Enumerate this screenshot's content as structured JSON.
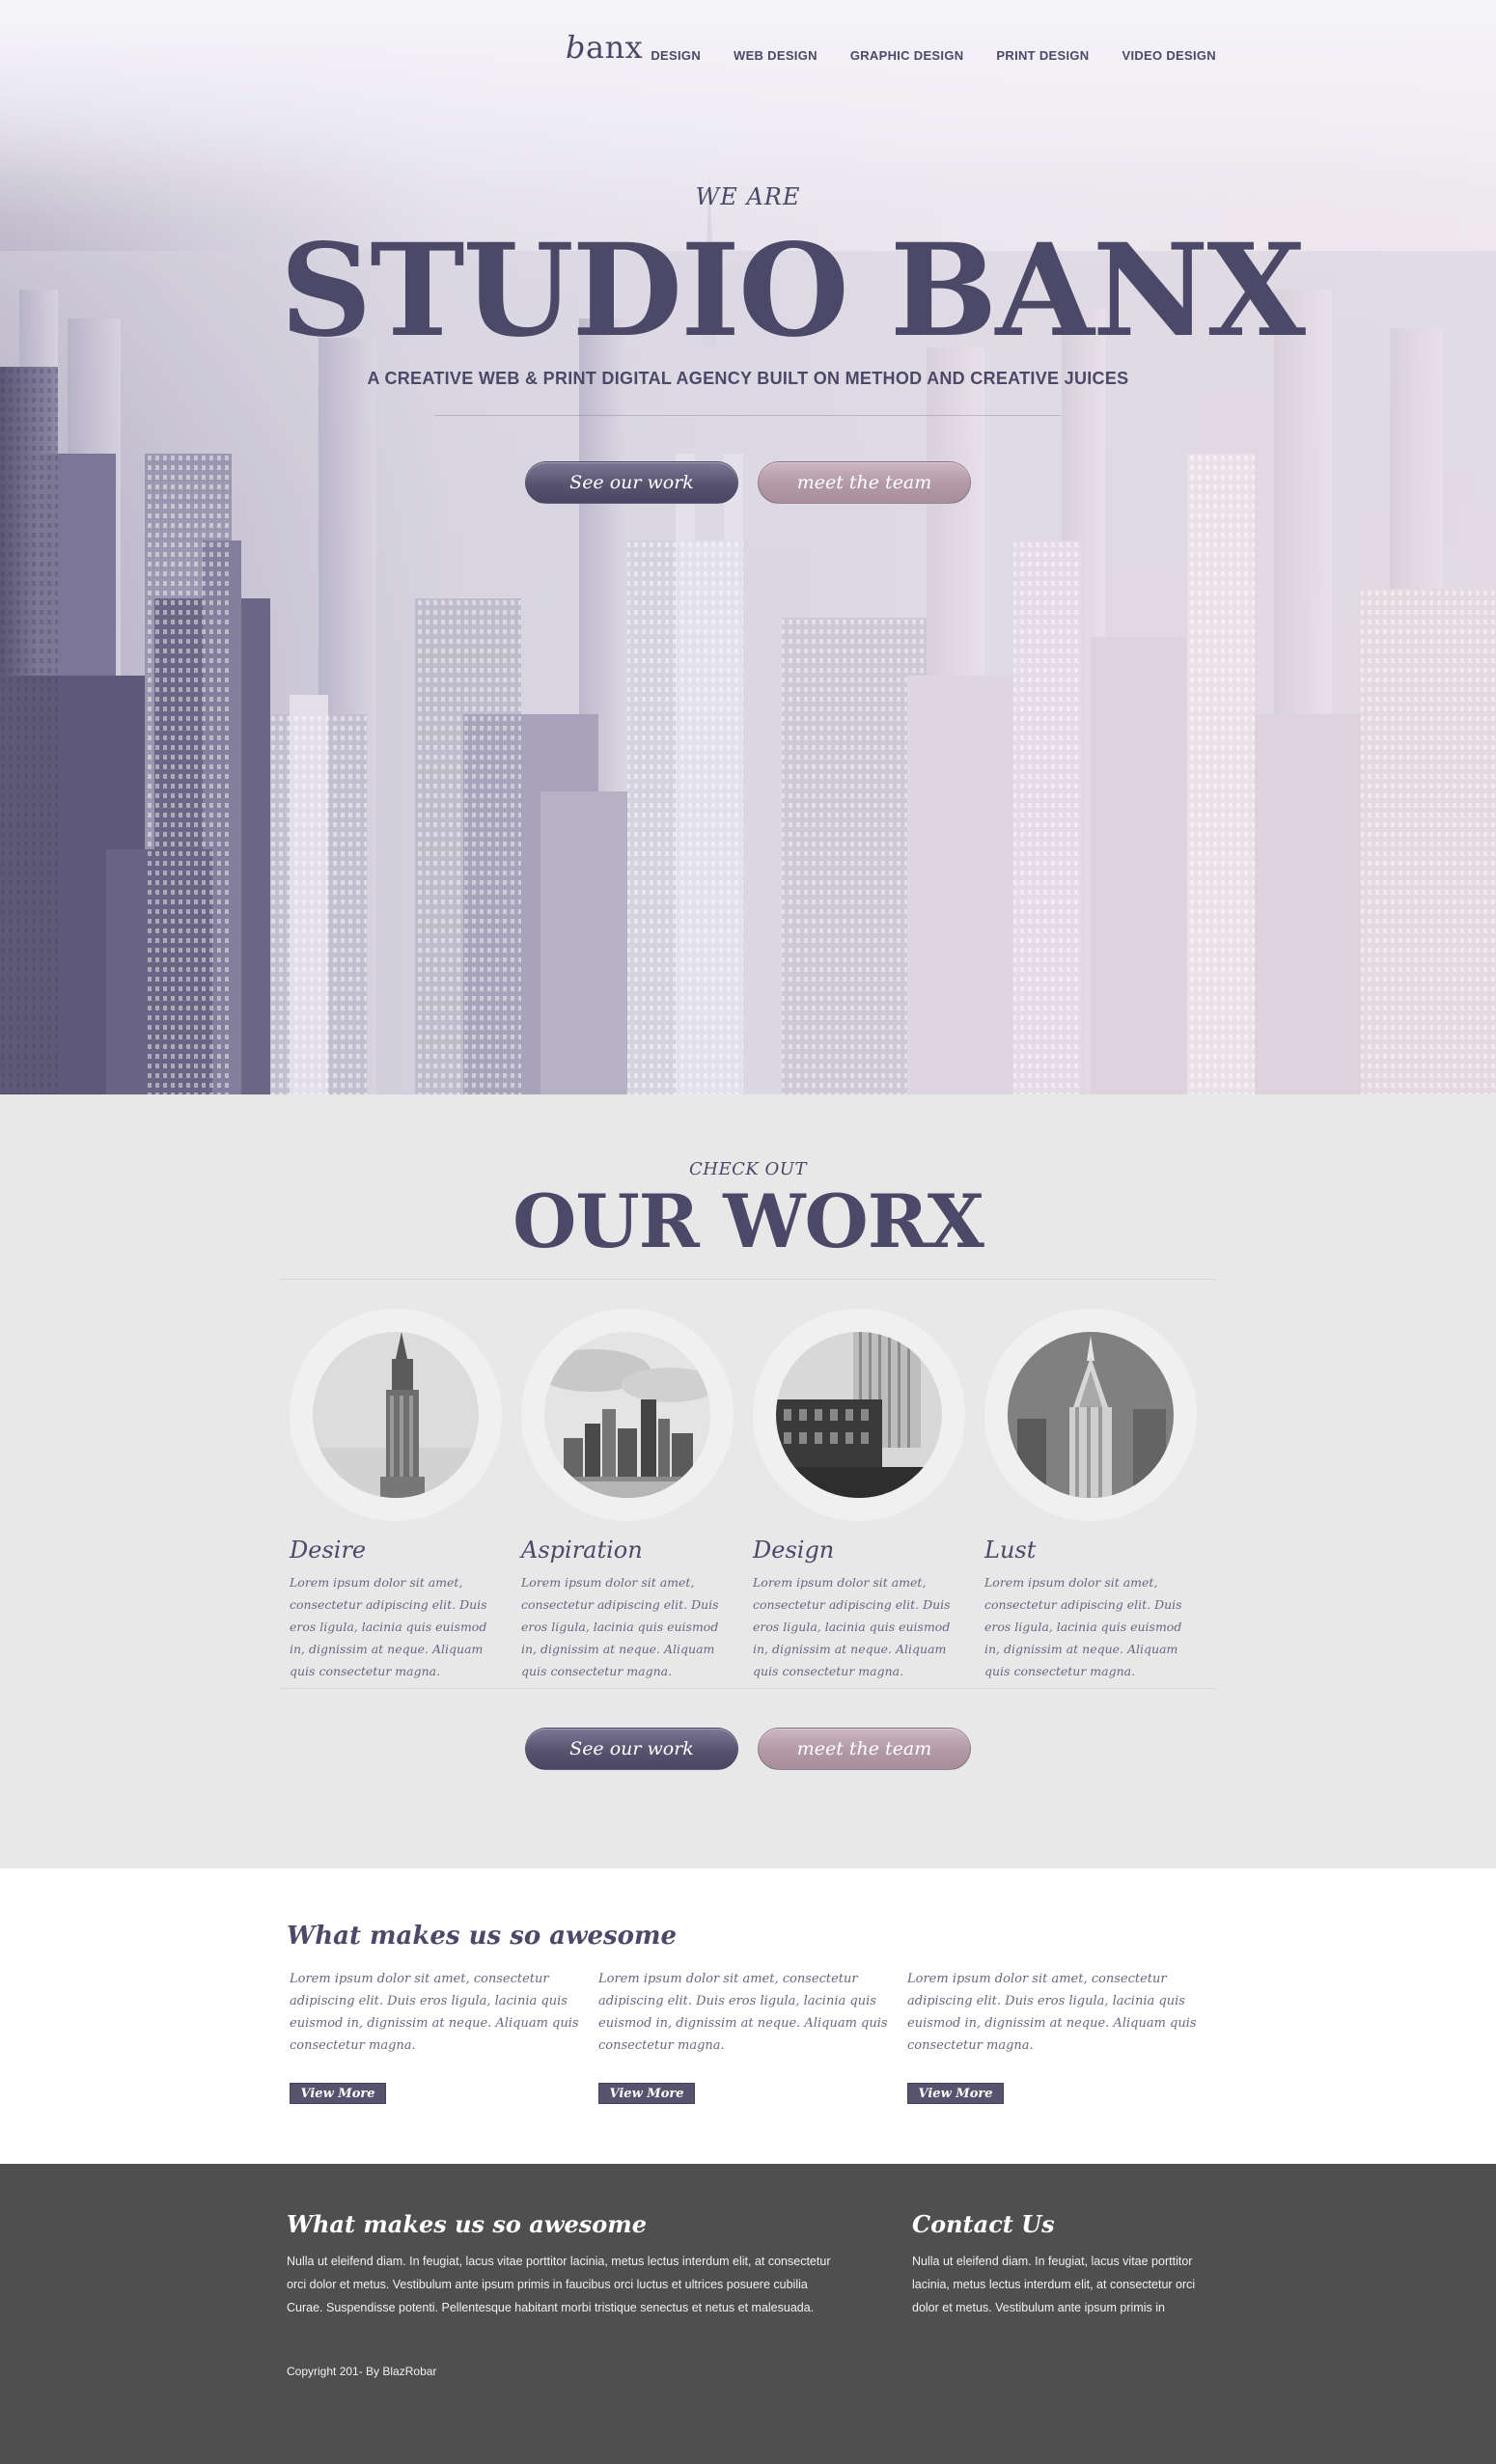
{
  "header": {
    "logo_initial": "b",
    "logo_rest": "anx",
    "nav": [
      "DESIGN",
      "WEB DESIGN",
      "GRAPHIC DESIGN",
      "PRINT DESIGN",
      "VIDEO DESIGN"
    ]
  },
  "hero": {
    "eyebrow": "WE ARE",
    "title": "STUDIO BANX",
    "tagline": "A CREATIVE WEB & PRINT DIGITAL AGENCY BUILT ON METHOD AND CREATIVE JUICES",
    "primary_button": "See our work",
    "secondary_button": "meet the team"
  },
  "worx": {
    "eyebrow": "CHECK OUT",
    "title": "OUR WORX",
    "cards": [
      {
        "title": "Desire",
        "text": "Lorem ipsum dolor sit amet, consectetur adipiscing elit. Duis eros ligula, lacinia quis euismod in, dignissim at neque. Aliquam quis consectetur magna."
      },
      {
        "title": "Aspiration",
        "text": "Lorem ipsum dolor sit amet, consectetur adipiscing elit. Duis eros ligula, lacinia quis euismod in, dignissim at neque. Aliquam quis consectetur magna."
      },
      {
        "title": "Design",
        "text": "Lorem ipsum dolor sit amet, consectetur adipiscing elit. Duis eros ligula, lacinia quis euismod in, dignissim at neque. Aliquam quis consectetur magna."
      },
      {
        "title": "Lust",
        "text": "Lorem ipsum dolor sit amet, consectetur adipiscing elit. Duis eros ligula, lacinia quis euismod in, dignissim at neque. Aliquam quis consectetur magna."
      }
    ],
    "primary_button": "See our work",
    "secondary_button": "meet the team"
  },
  "awesome": {
    "title": "What makes us so awesome",
    "columns": [
      {
        "text": "Lorem ipsum dolor sit amet, consectetur adipiscing elit. Duis eros ligula, lacinia quis euismod in, dignissim at neque. Aliquam quis consectetur magna.",
        "button": "View More"
      },
      {
        "text": "Lorem ipsum dolor sit amet, consectetur adipiscing elit. Duis eros ligula, lacinia quis euismod in, dignissim at neque. Aliquam quis consectetur magna.",
        "button": "View More"
      },
      {
        "text": "Lorem ipsum dolor sit amet, consectetur adipiscing elit. Duis eros ligula, lacinia quis euismod in, dignissim at neque. Aliquam quis consectetur magna.",
        "button": "View More"
      }
    ]
  },
  "footer": {
    "left_title": "What makes us so awesome",
    "left_text": "Nulla ut eleifend diam. In feugiat, lacus vitae porttitor lacinia, metus lectus interdum elit, at consectetur orci dolor et metus. Vestibulum ante ipsum primis in faucibus orci luctus et ultrices posuere cubilia Curae. Suspendisse potenti. Pellentesque habitant morbi tristique senectus et netus et malesuada.",
    "right_title": "Contact Us",
    "right_text": "Nulla ut eleifend diam. In feugiat, lacus vitae porttitor lacinia, metus lectus interdum elit, at consectetur orci dolor et metus. Vestibulum ante ipsum primis in",
    "copyright": "Copyright 201- By BlazRobar"
  },
  "colors": {
    "brand": "#4c4868",
    "accent_rose": "#b299a5",
    "worx_bg": "#e9e8e9",
    "footer_bg": "#4f4f4f"
  },
  "icons": {
    "hero_background": "city-skyline-photo",
    "card_photos": [
      "woolworth-tower-photo",
      "manhattan-skyline-photo",
      "old-building-photo",
      "chrysler-building-photo"
    ]
  }
}
